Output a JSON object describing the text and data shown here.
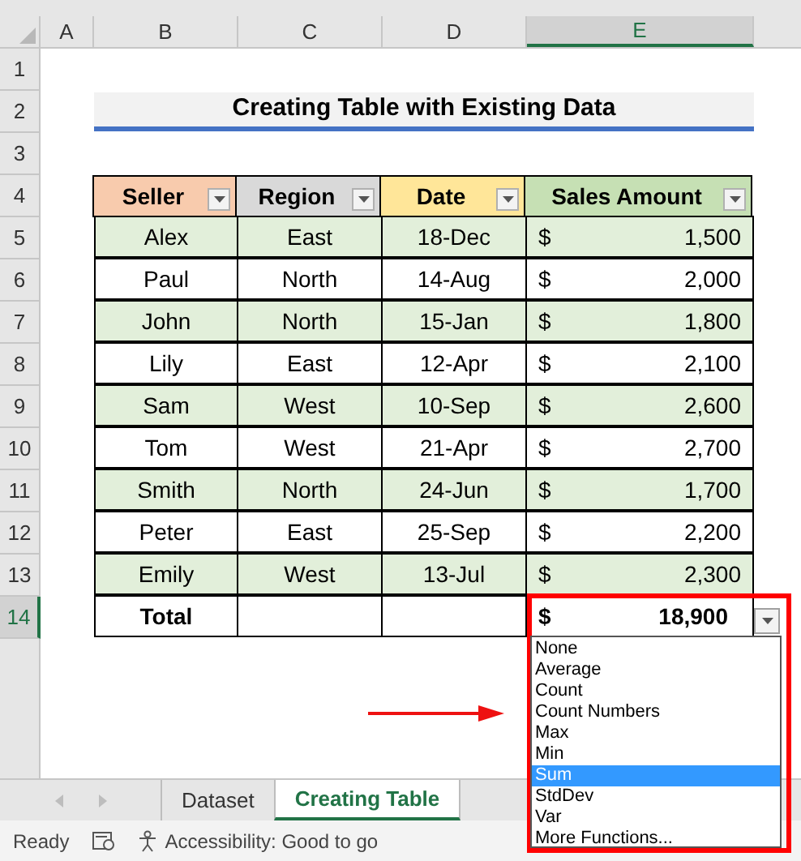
{
  "column_letters": [
    {
      "label": "A",
      "selected": false
    },
    {
      "label": "B",
      "selected": false
    },
    {
      "label": "C",
      "selected": false
    },
    {
      "label": "D",
      "selected": false
    },
    {
      "label": "E",
      "selected": true
    }
  ],
  "row_numbers": [
    {
      "label": "1",
      "selected": false
    },
    {
      "label": "2",
      "selected": false
    },
    {
      "label": "3",
      "selected": false
    },
    {
      "label": "4",
      "selected": false
    },
    {
      "label": "5",
      "selected": false
    },
    {
      "label": "6",
      "selected": false
    },
    {
      "label": "7",
      "selected": false
    },
    {
      "label": "8",
      "selected": false
    },
    {
      "label": "9",
      "selected": false
    },
    {
      "label": "10",
      "selected": false
    },
    {
      "label": "11",
      "selected": false
    },
    {
      "label": "12",
      "selected": false
    },
    {
      "label": "13",
      "selected": false
    },
    {
      "label": "14",
      "selected": true
    }
  ],
  "title": "Creating Table with Existing Data",
  "table": {
    "columns": [
      {
        "label": "Seller",
        "color": "#f8cbad"
      },
      {
        "label": "Region",
        "color": "#d9d9d9"
      },
      {
        "label": "Date",
        "color": "#ffe699"
      },
      {
        "label": "Sales Amount",
        "color": "#c6e0b4"
      }
    ],
    "rows": [
      {
        "seller": "Alex",
        "region": "East",
        "date": "18-Dec",
        "currency": "$",
        "amount": "1,500"
      },
      {
        "seller": "Paul",
        "region": "North",
        "date": "14-Aug",
        "currency": "$",
        "amount": "2,000"
      },
      {
        "seller": "John",
        "region": "North",
        "date": "15-Jan",
        "currency": "$",
        "amount": "1,800"
      },
      {
        "seller": "Lily",
        "region": "East",
        "date": "12-Apr",
        "currency": "$",
        "amount": "2,100"
      },
      {
        "seller": "Sam",
        "region": "West",
        "date": "10-Sep",
        "currency": "$",
        "amount": "2,600"
      },
      {
        "seller": "Tom",
        "region": "West",
        "date": "21-Apr",
        "currency": "$",
        "amount": "2,700"
      },
      {
        "seller": "Smith",
        "region": "North",
        "date": "24-Jun",
        "currency": "$",
        "amount": "1,700"
      },
      {
        "seller": "Peter",
        "region": "East",
        "date": "25-Sep",
        "currency": "$",
        "amount": "2,200"
      },
      {
        "seller": "Emily",
        "region": "West",
        "date": "13-Jul",
        "currency": "$",
        "amount": "2,300"
      }
    ],
    "total": {
      "label": "Total",
      "currency": "$",
      "amount": "18,900"
    }
  },
  "total_menu": [
    {
      "label": "None",
      "selected": false
    },
    {
      "label": "Average",
      "selected": false
    },
    {
      "label": "Count",
      "selected": false
    },
    {
      "label": "Count Numbers",
      "selected": false
    },
    {
      "label": "Max",
      "selected": false
    },
    {
      "label": "Min",
      "selected": false
    },
    {
      "label": "Sum",
      "selected": true
    },
    {
      "label": "StdDev",
      "selected": false
    },
    {
      "label": "Var",
      "selected": false
    },
    {
      "label": "More Functions...",
      "selected": false
    }
  ],
  "sheet_tabs": [
    {
      "label": "Dataset",
      "selected": false
    },
    {
      "label": "Creating Table",
      "selected": true
    }
  ],
  "status_bar": {
    "mode": "Ready",
    "accessibility": "Accessibility: Good to go"
  }
}
